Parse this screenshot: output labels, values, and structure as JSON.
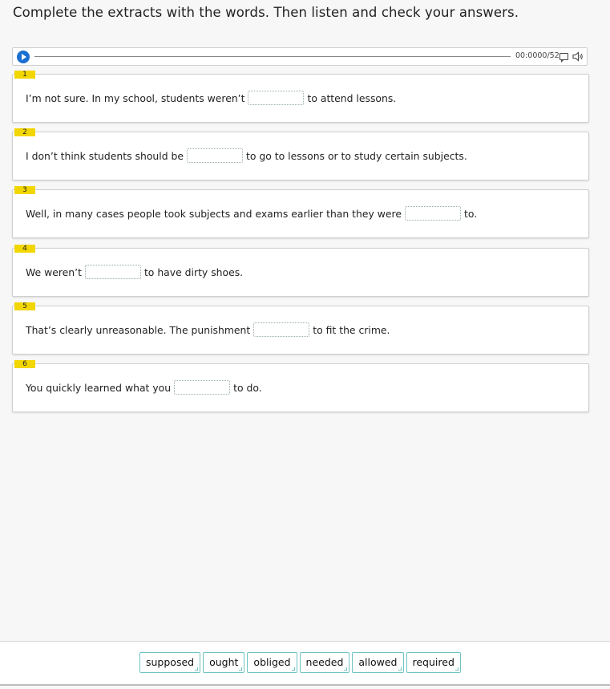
{
  "instruction": "Complete the extracts with the words. Then listen and check your answers.",
  "player": {
    "time": "00:00",
    "duration": "00/52",
    "progress": 0
  },
  "questions": [
    {
      "num": "1",
      "before": "I’m not sure. In my school, students weren’t",
      "after": "to attend lessons."
    },
    {
      "num": "2",
      "before": "I don’t think students should be",
      "after": "to go to lessons or to study certain subjects."
    },
    {
      "num": "3",
      "before": "Well, in many cases people took subjects and exams earlier than they were",
      "after": "to."
    },
    {
      "num": "4",
      "before": "We weren’t",
      "after": "to have dirty shoes."
    },
    {
      "num": "5",
      "before": "That’s clearly unreasonable. The punishment",
      "after": "to fit the crime."
    },
    {
      "num": "6",
      "before": "You quickly learned what you",
      "after": "to do."
    }
  ],
  "word_bank": [
    "supposed",
    "ought",
    "obliged",
    "needed",
    "allowed",
    "required"
  ],
  "colors": {
    "number_badge": "#f2d600",
    "play_button": "#1a6fd0",
    "word_border": "#6fc3c3"
  },
  "icons": {
    "play": "play-icon",
    "transcript": "transcript-icon",
    "volume": "volume-icon"
  }
}
